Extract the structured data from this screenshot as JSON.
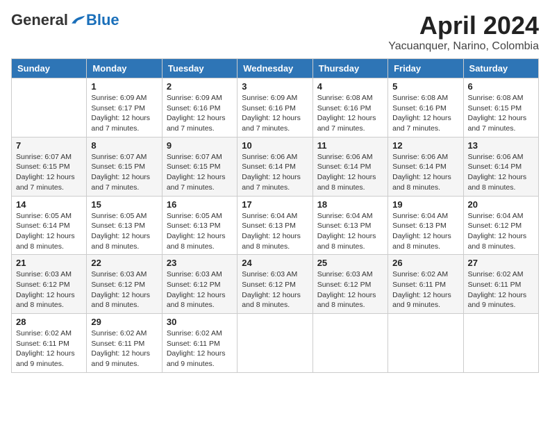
{
  "logo": {
    "general": "General",
    "blue": "Blue"
  },
  "title": "April 2024",
  "location": "Yacuanquer, Narino, Colombia",
  "headers": [
    "Sunday",
    "Monday",
    "Tuesday",
    "Wednesday",
    "Thursday",
    "Friday",
    "Saturday"
  ],
  "weeks": [
    [
      {
        "day": "",
        "info": ""
      },
      {
        "day": "1",
        "info": "Sunrise: 6:09 AM\nSunset: 6:17 PM\nDaylight: 12 hours\nand 7 minutes."
      },
      {
        "day": "2",
        "info": "Sunrise: 6:09 AM\nSunset: 6:16 PM\nDaylight: 12 hours\nand 7 minutes."
      },
      {
        "day": "3",
        "info": "Sunrise: 6:09 AM\nSunset: 6:16 PM\nDaylight: 12 hours\nand 7 minutes."
      },
      {
        "day": "4",
        "info": "Sunrise: 6:08 AM\nSunset: 6:16 PM\nDaylight: 12 hours\nand 7 minutes."
      },
      {
        "day": "5",
        "info": "Sunrise: 6:08 AM\nSunset: 6:16 PM\nDaylight: 12 hours\nand 7 minutes."
      },
      {
        "day": "6",
        "info": "Sunrise: 6:08 AM\nSunset: 6:15 PM\nDaylight: 12 hours\nand 7 minutes."
      }
    ],
    [
      {
        "day": "7",
        "info": "Sunrise: 6:07 AM\nSunset: 6:15 PM\nDaylight: 12 hours\nand 7 minutes."
      },
      {
        "day": "8",
        "info": "Sunrise: 6:07 AM\nSunset: 6:15 PM\nDaylight: 12 hours\nand 7 minutes."
      },
      {
        "day": "9",
        "info": "Sunrise: 6:07 AM\nSunset: 6:15 PM\nDaylight: 12 hours\nand 7 minutes."
      },
      {
        "day": "10",
        "info": "Sunrise: 6:06 AM\nSunset: 6:14 PM\nDaylight: 12 hours\nand 7 minutes."
      },
      {
        "day": "11",
        "info": "Sunrise: 6:06 AM\nSunset: 6:14 PM\nDaylight: 12 hours\nand 8 minutes."
      },
      {
        "day": "12",
        "info": "Sunrise: 6:06 AM\nSunset: 6:14 PM\nDaylight: 12 hours\nand 8 minutes."
      },
      {
        "day": "13",
        "info": "Sunrise: 6:06 AM\nSunset: 6:14 PM\nDaylight: 12 hours\nand 8 minutes."
      }
    ],
    [
      {
        "day": "14",
        "info": "Sunrise: 6:05 AM\nSunset: 6:14 PM\nDaylight: 12 hours\nand 8 minutes."
      },
      {
        "day": "15",
        "info": "Sunrise: 6:05 AM\nSunset: 6:13 PM\nDaylight: 12 hours\nand 8 minutes."
      },
      {
        "day": "16",
        "info": "Sunrise: 6:05 AM\nSunset: 6:13 PM\nDaylight: 12 hours\nand 8 minutes."
      },
      {
        "day": "17",
        "info": "Sunrise: 6:04 AM\nSunset: 6:13 PM\nDaylight: 12 hours\nand 8 minutes."
      },
      {
        "day": "18",
        "info": "Sunrise: 6:04 AM\nSunset: 6:13 PM\nDaylight: 12 hours\nand 8 minutes."
      },
      {
        "day": "19",
        "info": "Sunrise: 6:04 AM\nSunset: 6:13 PM\nDaylight: 12 hours\nand 8 minutes."
      },
      {
        "day": "20",
        "info": "Sunrise: 6:04 AM\nSunset: 6:12 PM\nDaylight: 12 hours\nand 8 minutes."
      }
    ],
    [
      {
        "day": "21",
        "info": "Sunrise: 6:03 AM\nSunset: 6:12 PM\nDaylight: 12 hours\nand 8 minutes."
      },
      {
        "day": "22",
        "info": "Sunrise: 6:03 AM\nSunset: 6:12 PM\nDaylight: 12 hours\nand 8 minutes."
      },
      {
        "day": "23",
        "info": "Sunrise: 6:03 AM\nSunset: 6:12 PM\nDaylight: 12 hours\nand 8 minutes."
      },
      {
        "day": "24",
        "info": "Sunrise: 6:03 AM\nSunset: 6:12 PM\nDaylight: 12 hours\nand 8 minutes."
      },
      {
        "day": "25",
        "info": "Sunrise: 6:03 AM\nSunset: 6:12 PM\nDaylight: 12 hours\nand 8 minutes."
      },
      {
        "day": "26",
        "info": "Sunrise: 6:02 AM\nSunset: 6:11 PM\nDaylight: 12 hours\nand 9 minutes."
      },
      {
        "day": "27",
        "info": "Sunrise: 6:02 AM\nSunset: 6:11 PM\nDaylight: 12 hours\nand 9 minutes."
      }
    ],
    [
      {
        "day": "28",
        "info": "Sunrise: 6:02 AM\nSunset: 6:11 PM\nDaylight: 12 hours\nand 9 minutes."
      },
      {
        "day": "29",
        "info": "Sunrise: 6:02 AM\nSunset: 6:11 PM\nDaylight: 12 hours\nand 9 minutes."
      },
      {
        "day": "30",
        "info": "Sunrise: 6:02 AM\nSunset: 6:11 PM\nDaylight: 12 hours\nand 9 minutes."
      },
      {
        "day": "",
        "info": ""
      },
      {
        "day": "",
        "info": ""
      },
      {
        "day": "",
        "info": ""
      },
      {
        "day": "",
        "info": ""
      }
    ]
  ]
}
